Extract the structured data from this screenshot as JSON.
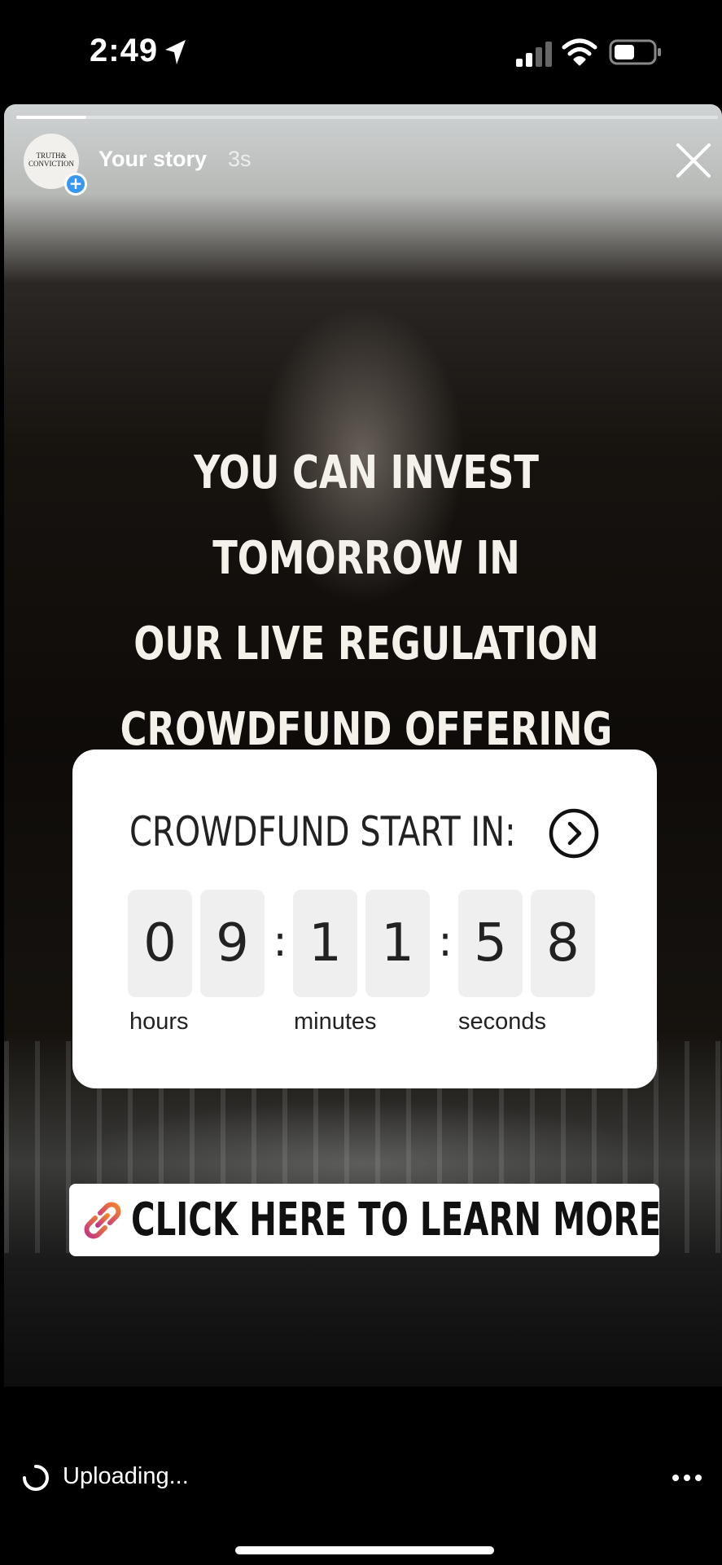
{
  "status_bar": {
    "time": "2:49",
    "icons": [
      "location-arrow-icon",
      "cellular-signal-icon",
      "wifi-icon",
      "battery-icon"
    ]
  },
  "story": {
    "progress": 0.1,
    "avatar_logo_line1": "TRUTH&",
    "avatar_logo_line2": "CONVICTION",
    "user_label": "Your story",
    "time_ago": "3s",
    "headline_line1": "YOU CAN INVEST TOMORROW IN",
    "headline_line2": "OUR LIVE REGULATION",
    "headline_line3": "CROWDFUND OFFERING"
  },
  "countdown": {
    "title": "CROWDFUND START IN:",
    "digits": [
      "0",
      "9",
      "1",
      "1",
      "5",
      "8"
    ],
    "separator": ":",
    "units": {
      "hours": "hours",
      "minutes": "minutes",
      "seconds": "seconds"
    }
  },
  "link_sticker": {
    "label": "CLICK HERE TO LEARN MORE",
    "icon": "link-icon"
  },
  "bottom_bar": {
    "upload_status": "Uploading...",
    "icons": [
      "loading-spinner-icon",
      "more-options-icon"
    ]
  },
  "colors": {
    "accent_blue": "#3897f0",
    "link_gradient_start": "#f58529",
    "link_gradient_end": "#c13584"
  }
}
